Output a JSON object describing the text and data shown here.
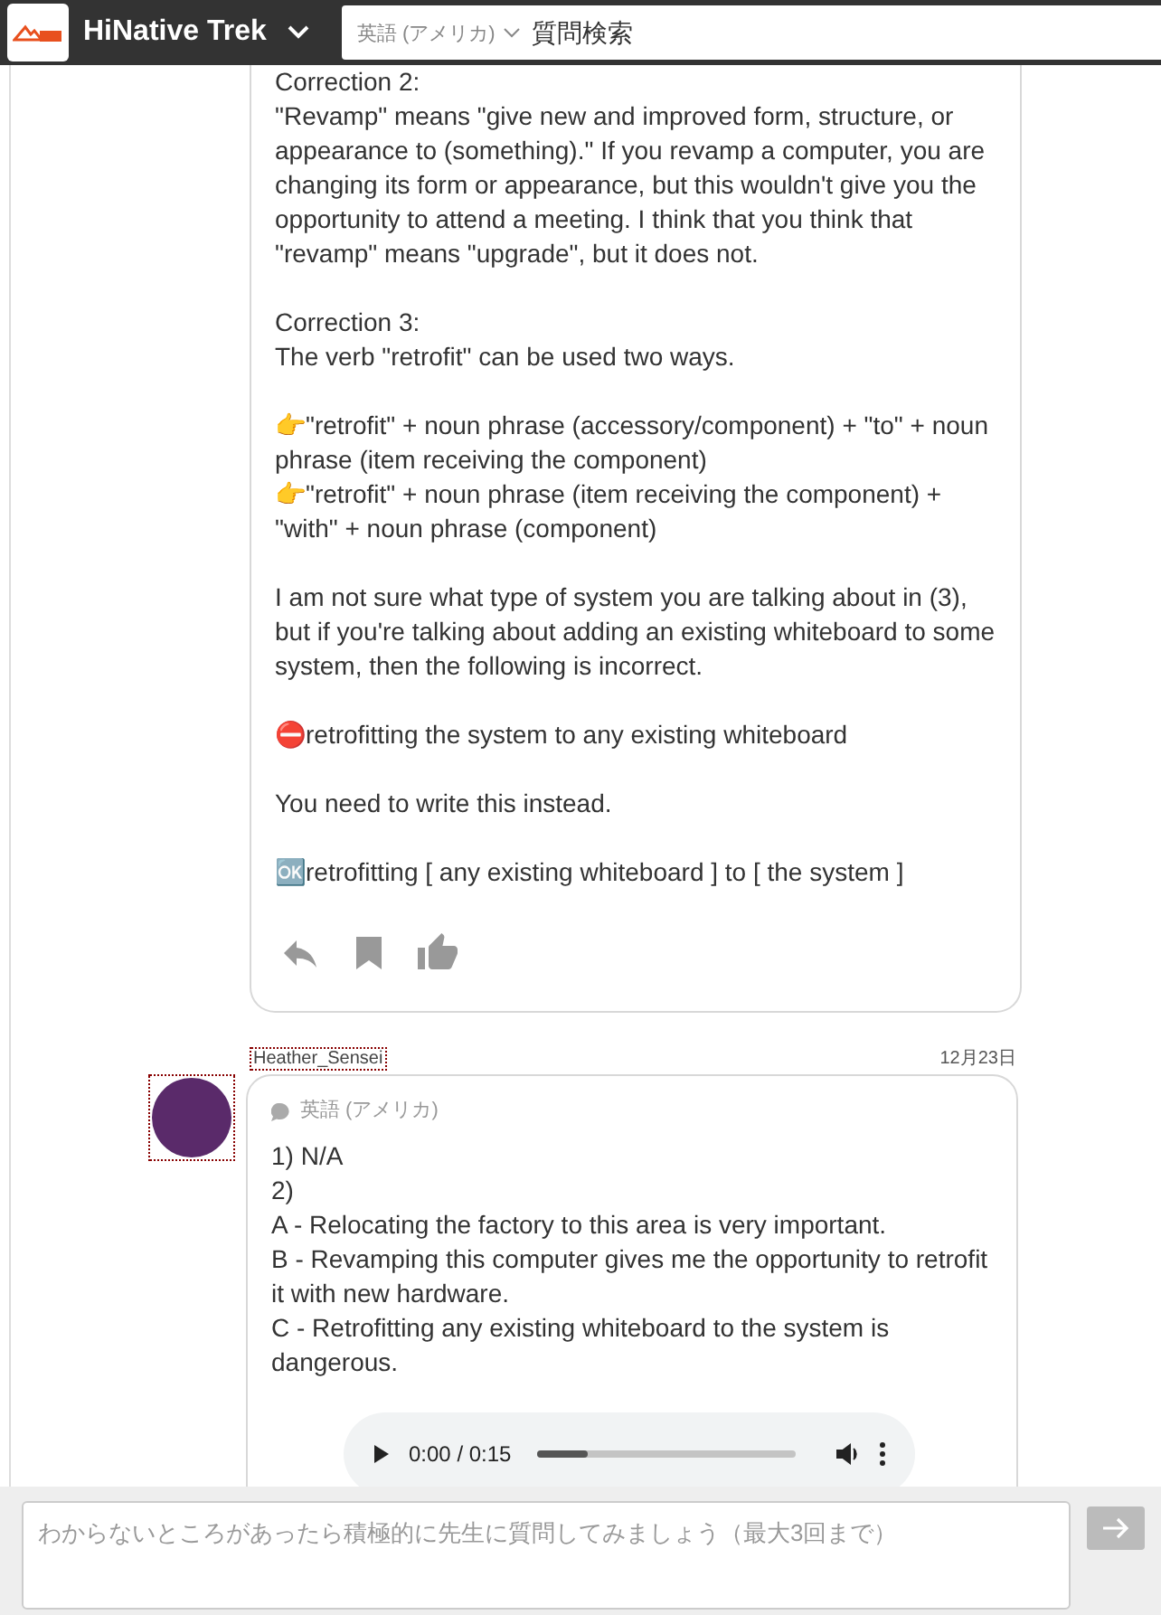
{
  "header": {
    "app_name": "HiNative Trek",
    "search": {
      "language": "英語 (アメリカ)",
      "placeholder": "質問検索"
    }
  },
  "answer_card": {
    "paragraphs": [
      [
        "Correction 2:",
        "\"Revamp\" means \"give new and improved form, structure, or appearance to (something).\" If you revamp a computer, you are changing its form or appearance, but this wouldn't give you the opportunity to attend a meeting. I think that you think that \"revamp\" means \"upgrade\", but it does not."
      ],
      [
        "Correction 3:",
        "The verb \"retrofit\" can be used two ways."
      ],
      [
        "👉\"retrofit\" + noun phrase (accessory/component) + \"to\" + noun phrase (item receiving the component)",
        "👉\"retrofit\" + noun phrase (item receiving the component) + \"with\" + noun phrase (component)"
      ],
      [
        "I am not sure what type of system you are talking about in (3), but if you're talking about adding an existing whiteboard to some system, then the following is incorrect."
      ],
      [
        "⛔retrofitting the system to any existing whiteboard"
      ],
      [
        "You need to write this instead."
      ],
      [
        "🆗retrofitting [ any existing whiteboard ] to [ the system ]"
      ]
    ]
  },
  "message": {
    "author": "Heather_Sensei",
    "date": "12月23日",
    "language": "英語 (アメリカ)",
    "lines": [
      "1) N/A",
      "2)",
      "A - Relocating the factory to this area is very important.",
      "B - Revamping this computer gives me the opportunity to retrofit it with new hardware.",
      "C - Retrofitting any existing whiteboard to the system is dangerous."
    ],
    "audio": {
      "time": "0:00 / 0:15",
      "level": 0.2
    }
  },
  "composer": {
    "placeholder": "わからないところがあったら積極的に先生に質問してみましょう（最大3回まで）"
  }
}
